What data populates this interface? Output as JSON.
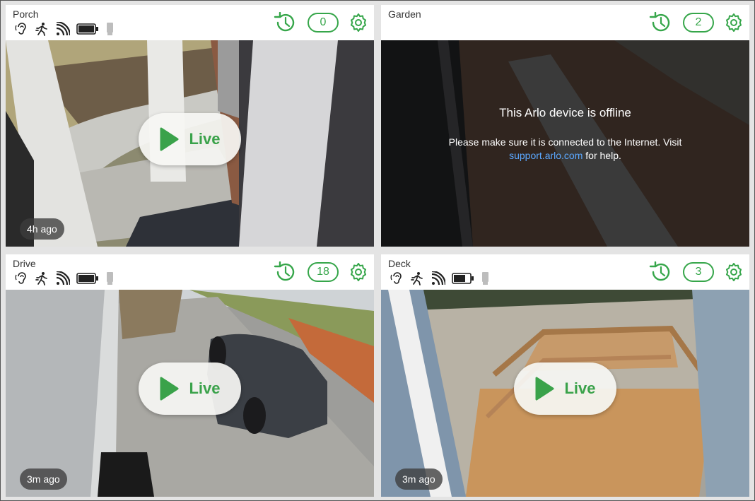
{
  "colors": {
    "accent": "#36a64a",
    "link": "#5ba8ff"
  },
  "cameras": [
    {
      "name": "Porch",
      "count": "0",
      "last_seen": "4h ago",
      "live_label": "Live",
      "status_icons": [
        "audio-icon",
        "motion-icon",
        "signal-icon",
        "battery-icon",
        "power-icon"
      ]
    },
    {
      "name": "Garden",
      "count": "2",
      "offline": {
        "title": "This Arlo device is offline",
        "message": "Please make sure it is connected to the Internet. Visit",
        "link": "support.arlo.com",
        "suffix": "for help."
      }
    },
    {
      "name": "Drive",
      "count": "18",
      "last_seen": "3m ago",
      "live_label": "Live",
      "status_icons": [
        "audio-icon",
        "motion-icon",
        "signal-icon",
        "battery-icon",
        "power-icon"
      ]
    },
    {
      "name": "Deck",
      "count": "3",
      "last_seen": "3m ago",
      "live_label": "Live",
      "status_icons": [
        "audio-icon",
        "motion-icon",
        "signal-icon",
        "battery-icon",
        "power-icon"
      ]
    }
  ]
}
